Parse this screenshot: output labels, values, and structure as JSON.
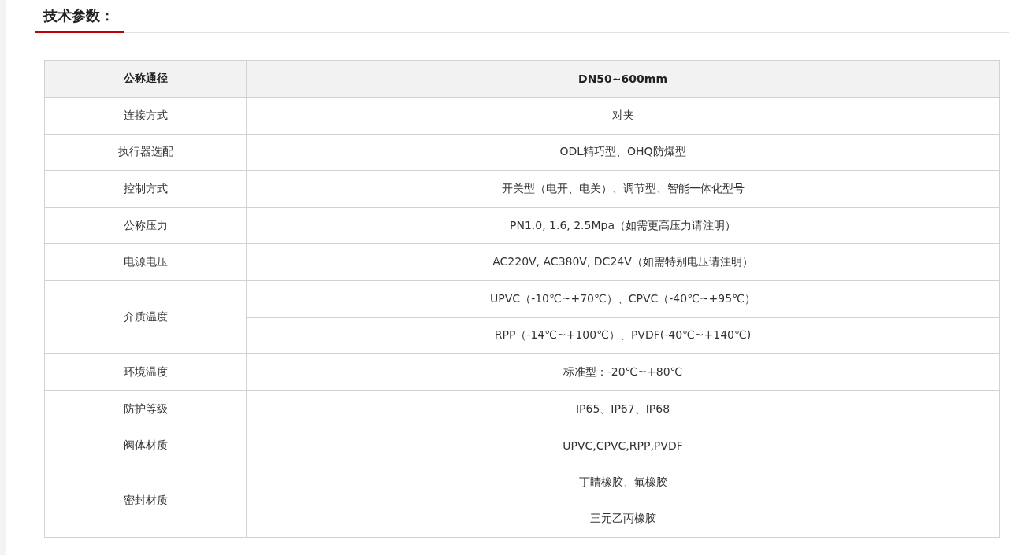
{
  "section_title": "技术参数：",
  "table": {
    "header": {
      "label": "公称通径",
      "value": "DN50~600mm"
    },
    "rows": [
      {
        "label": "连接方式",
        "values": [
          "对夹"
        ]
      },
      {
        "label": "执行器选配",
        "values": [
          "ODL精巧型、OHQ防爆型"
        ]
      },
      {
        "label": "控制方式",
        "values": [
          "开关型（电开、电关）、调节型、智能一体化型号"
        ]
      },
      {
        "label": "公称压力",
        "values": [
          "PN1.0, 1.6, 2.5Mpa（如需更高压力请注明）"
        ]
      },
      {
        "label": "电源电压",
        "values": [
          "AC220V, AC380V, DC24V（如需特别电压请注明）"
        ]
      },
      {
        "label": "介质温度",
        "values": [
          "UPVC（-10℃~+70℃）、CPVC（-40℃~+95℃）",
          "RPP（-14℃~+100℃）、PVDF(-40℃~+140℃)"
        ]
      },
      {
        "label": "环境温度",
        "values": [
          "标准型：-20℃~+80℃"
        ]
      },
      {
        "label": "防护等级",
        "values": [
          "IP65、IP67、IP68"
        ]
      },
      {
        "label": "阀体材质",
        "values": [
          "UPVC,CPVC,RPP,PVDF"
        ]
      },
      {
        "label": "密封材质",
        "values": [
          "丁睛橡胶、氟橡胶",
          "三元乙丙橡胶"
        ]
      }
    ]
  }
}
